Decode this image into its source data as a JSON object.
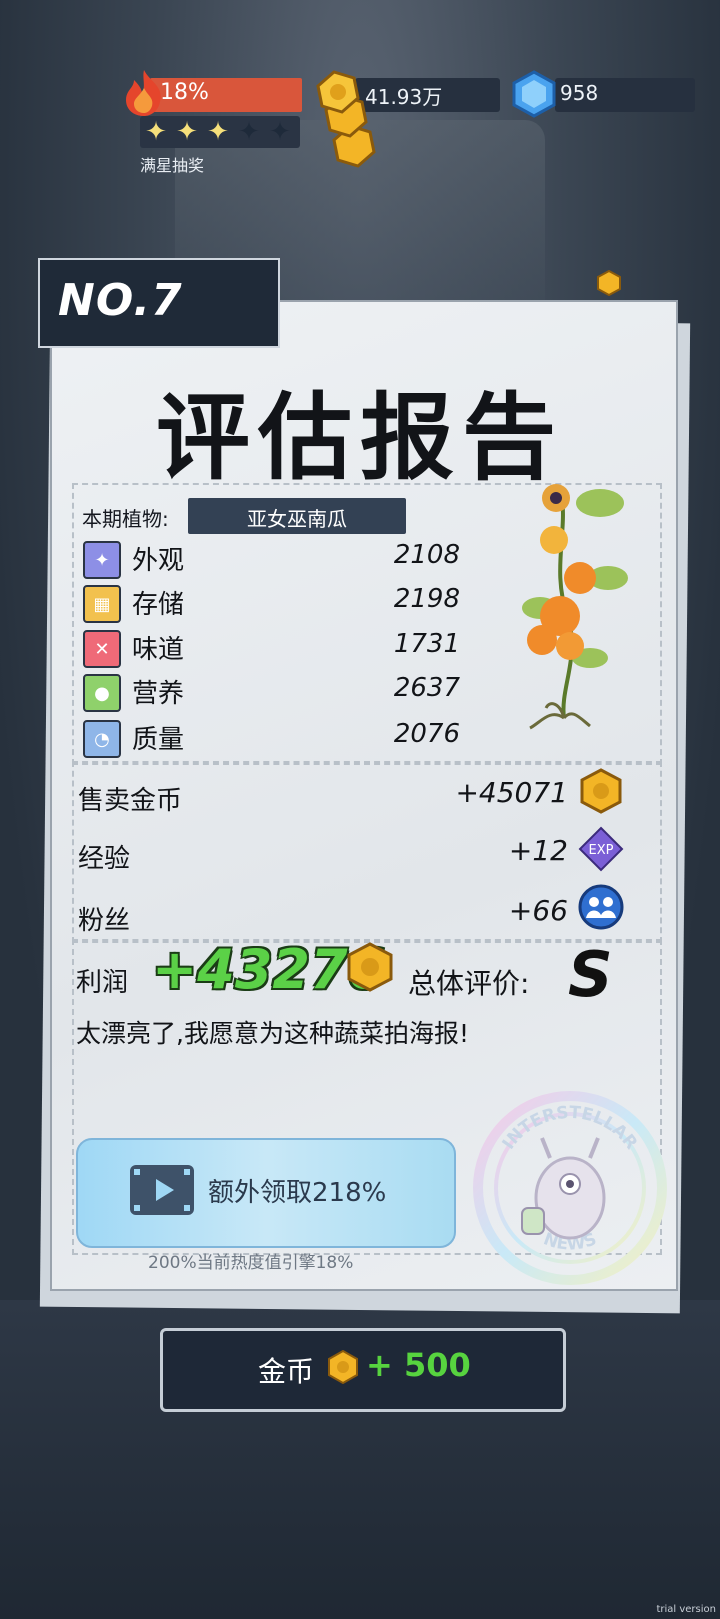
{
  "hud": {
    "heat_percent_label": "18%",
    "stars_filled": 3,
    "stars_total": 5,
    "stars_caption": "满星抽奖",
    "coins": "41.93万",
    "gems": "958"
  },
  "report": {
    "number": "NO.7",
    "title": "评估报告",
    "plant_label": "本期植物:",
    "plant_name": "亚女巫南瓜",
    "stats": [
      {
        "label": "外观",
        "value": "2108",
        "icon": "sparkle-icon",
        "color": "#8d8fe6"
      },
      {
        "label": "存储",
        "value": "2198",
        "icon": "box-icon",
        "color": "#f2c14e"
      },
      {
        "label": "味道",
        "value": "1731",
        "icon": "utensils-icon",
        "color": "#ef6a78"
      },
      {
        "label": "营养",
        "value": "2637",
        "icon": "apple-icon",
        "color": "#8fd16b"
      },
      {
        "label": "质量",
        "value": "2076",
        "icon": "muscle-icon",
        "color": "#8fb6e8"
      }
    ],
    "sell_label": "售卖金币",
    "sell_value": "+45071",
    "exp_label": "经验",
    "exp_value": "+12",
    "exp_badge": "EXP",
    "fans_label": "粉丝",
    "fans_value": "+66",
    "profit_label": "利润",
    "profit_value": "+43276",
    "overall_label": "总体评价:",
    "grade": "S",
    "comment": "太漂亮了,我愿意为这种蔬菜拍海报!",
    "watch_button": "额外领取218%",
    "hint": "200%当前热度值引擎18%",
    "stamp_top": "INTERSTELLAR",
    "stamp_bottom": "NEWS"
  },
  "collect": {
    "label": "金币",
    "value": "+ 500"
  },
  "footer": {
    "trial": "trial version"
  },
  "colors": {
    "heat": "#d9563b",
    "profit_green": "#5bd147",
    "coin_gold": "#f3b526",
    "gem_blue": "#4aa3ef"
  }
}
